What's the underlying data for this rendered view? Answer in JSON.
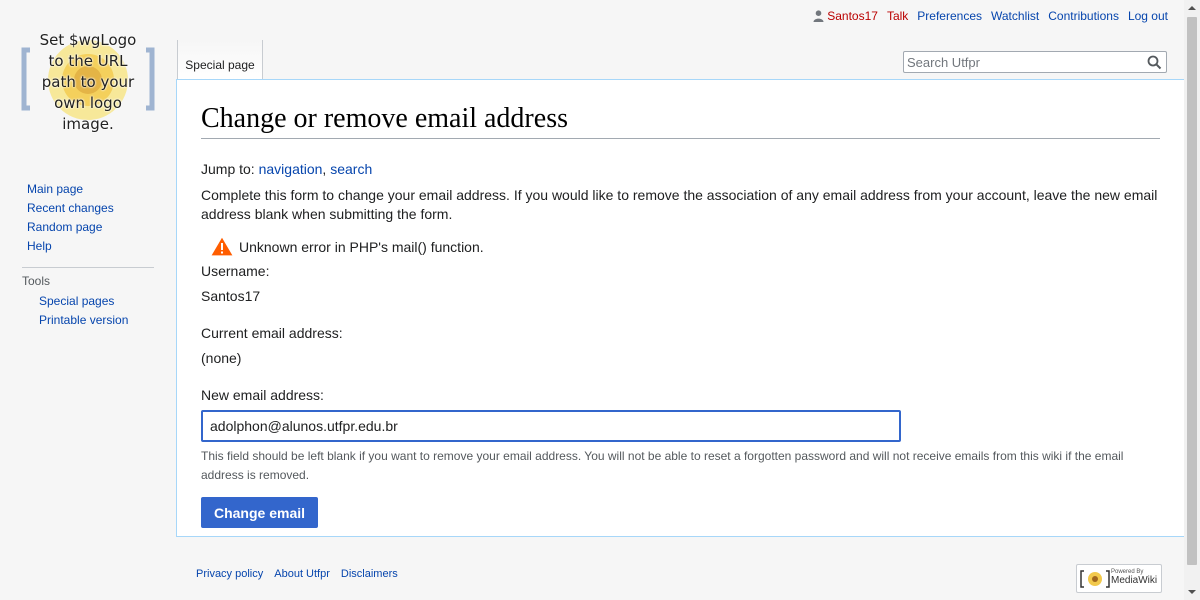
{
  "personal": {
    "username": "Santos17",
    "talk": "Talk",
    "preferences": "Preferences",
    "watchlist": "Watchlist",
    "contributions": "Contributions",
    "logout": "Log out"
  },
  "logo": {
    "lines": [
      "Set $wgLogo",
      "to the URL",
      "path to your",
      "own logo",
      "image."
    ]
  },
  "sidebar": {
    "nav": [
      "Main page",
      "Recent changes",
      "Random page",
      "Help"
    ],
    "tools_heading": "Tools",
    "tools": [
      "Special pages",
      "Printable version"
    ]
  },
  "tabs": {
    "special": "Special page"
  },
  "search": {
    "placeholder": "Search Utfpr"
  },
  "page": {
    "title": "Change or remove email address",
    "jump_prefix": "Jump to:",
    "jump_nav": "navigation",
    "jump_sep": ",",
    "jump_search": "search",
    "intro": "Complete this form to change your email address. If you would like to remove the association of any email address from your account, leave the new email address blank when submitting the form.",
    "error": "Unknown error in PHP's mail() function.",
    "username_label": "Username:",
    "username_value": "Santos17",
    "current_label": "Current email address:",
    "current_value": "(none)",
    "new_label": "New email address:",
    "new_value": "adolphon@alunos.utfpr.edu.br",
    "help": "This field should be left blank if you want to remove your email address. You will not be able to reset a forgotten password and will not receive emails from this wiki if the email address is removed.",
    "submit": "Change email"
  },
  "footer": {
    "privacy": "Privacy policy",
    "about": "About Utfpr",
    "disclaimers": "Disclaimers",
    "powered_small": "Powered By",
    "powered_big": "MediaWiki"
  },
  "colors": {
    "link": "#0645ad",
    "redlink": "#ba0000",
    "primary": "#3366cc",
    "warning": "#ff5d00"
  }
}
